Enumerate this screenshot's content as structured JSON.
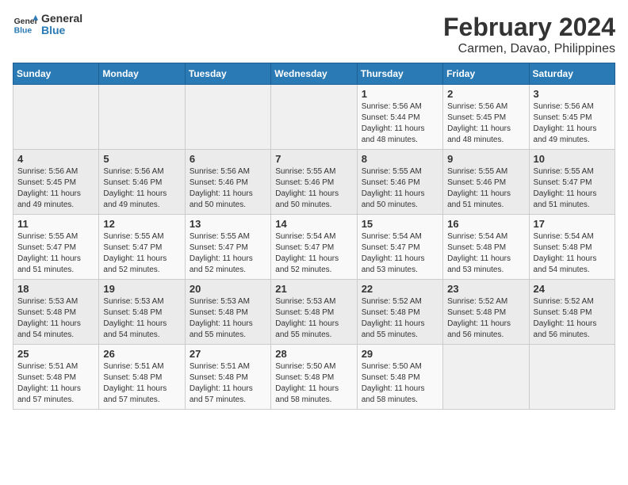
{
  "header": {
    "logo_line1": "General",
    "logo_line2": "Blue",
    "month_year": "February 2024",
    "location": "Carmen, Davao, Philippines"
  },
  "weekdays": [
    "Sunday",
    "Monday",
    "Tuesday",
    "Wednesday",
    "Thursday",
    "Friday",
    "Saturday"
  ],
  "weeks": [
    [
      {
        "day": "",
        "detail": ""
      },
      {
        "day": "",
        "detail": ""
      },
      {
        "day": "",
        "detail": ""
      },
      {
        "day": "",
        "detail": ""
      },
      {
        "day": "1",
        "detail": "Sunrise: 5:56 AM\nSunset: 5:44 PM\nDaylight: 11 hours\nand 48 minutes."
      },
      {
        "day": "2",
        "detail": "Sunrise: 5:56 AM\nSunset: 5:45 PM\nDaylight: 11 hours\nand 48 minutes."
      },
      {
        "day": "3",
        "detail": "Sunrise: 5:56 AM\nSunset: 5:45 PM\nDaylight: 11 hours\nand 49 minutes."
      }
    ],
    [
      {
        "day": "4",
        "detail": "Sunrise: 5:56 AM\nSunset: 5:45 PM\nDaylight: 11 hours\nand 49 minutes."
      },
      {
        "day": "5",
        "detail": "Sunrise: 5:56 AM\nSunset: 5:46 PM\nDaylight: 11 hours\nand 49 minutes."
      },
      {
        "day": "6",
        "detail": "Sunrise: 5:56 AM\nSunset: 5:46 PM\nDaylight: 11 hours\nand 50 minutes."
      },
      {
        "day": "7",
        "detail": "Sunrise: 5:55 AM\nSunset: 5:46 PM\nDaylight: 11 hours\nand 50 minutes."
      },
      {
        "day": "8",
        "detail": "Sunrise: 5:55 AM\nSunset: 5:46 PM\nDaylight: 11 hours\nand 50 minutes."
      },
      {
        "day": "9",
        "detail": "Sunrise: 5:55 AM\nSunset: 5:46 PM\nDaylight: 11 hours\nand 51 minutes."
      },
      {
        "day": "10",
        "detail": "Sunrise: 5:55 AM\nSunset: 5:47 PM\nDaylight: 11 hours\nand 51 minutes."
      }
    ],
    [
      {
        "day": "11",
        "detail": "Sunrise: 5:55 AM\nSunset: 5:47 PM\nDaylight: 11 hours\nand 51 minutes."
      },
      {
        "day": "12",
        "detail": "Sunrise: 5:55 AM\nSunset: 5:47 PM\nDaylight: 11 hours\nand 52 minutes."
      },
      {
        "day": "13",
        "detail": "Sunrise: 5:55 AM\nSunset: 5:47 PM\nDaylight: 11 hours\nand 52 minutes."
      },
      {
        "day": "14",
        "detail": "Sunrise: 5:54 AM\nSunset: 5:47 PM\nDaylight: 11 hours\nand 52 minutes."
      },
      {
        "day": "15",
        "detail": "Sunrise: 5:54 AM\nSunset: 5:47 PM\nDaylight: 11 hours\nand 53 minutes."
      },
      {
        "day": "16",
        "detail": "Sunrise: 5:54 AM\nSunset: 5:48 PM\nDaylight: 11 hours\nand 53 minutes."
      },
      {
        "day": "17",
        "detail": "Sunrise: 5:54 AM\nSunset: 5:48 PM\nDaylight: 11 hours\nand 54 minutes."
      }
    ],
    [
      {
        "day": "18",
        "detail": "Sunrise: 5:53 AM\nSunset: 5:48 PM\nDaylight: 11 hours\nand 54 minutes."
      },
      {
        "day": "19",
        "detail": "Sunrise: 5:53 AM\nSunset: 5:48 PM\nDaylight: 11 hours\nand 54 minutes."
      },
      {
        "day": "20",
        "detail": "Sunrise: 5:53 AM\nSunset: 5:48 PM\nDaylight: 11 hours\nand 55 minutes."
      },
      {
        "day": "21",
        "detail": "Sunrise: 5:53 AM\nSunset: 5:48 PM\nDaylight: 11 hours\nand 55 minutes."
      },
      {
        "day": "22",
        "detail": "Sunrise: 5:52 AM\nSunset: 5:48 PM\nDaylight: 11 hours\nand 55 minutes."
      },
      {
        "day": "23",
        "detail": "Sunrise: 5:52 AM\nSunset: 5:48 PM\nDaylight: 11 hours\nand 56 minutes."
      },
      {
        "day": "24",
        "detail": "Sunrise: 5:52 AM\nSunset: 5:48 PM\nDaylight: 11 hours\nand 56 minutes."
      }
    ],
    [
      {
        "day": "25",
        "detail": "Sunrise: 5:51 AM\nSunset: 5:48 PM\nDaylight: 11 hours\nand 57 minutes."
      },
      {
        "day": "26",
        "detail": "Sunrise: 5:51 AM\nSunset: 5:48 PM\nDaylight: 11 hours\nand 57 minutes."
      },
      {
        "day": "27",
        "detail": "Sunrise: 5:51 AM\nSunset: 5:48 PM\nDaylight: 11 hours\nand 57 minutes."
      },
      {
        "day": "28",
        "detail": "Sunrise: 5:50 AM\nSunset: 5:48 PM\nDaylight: 11 hours\nand 58 minutes."
      },
      {
        "day": "29",
        "detail": "Sunrise: 5:50 AM\nSunset: 5:48 PM\nDaylight: 11 hours\nand 58 minutes."
      },
      {
        "day": "",
        "detail": ""
      },
      {
        "day": "",
        "detail": ""
      }
    ]
  ]
}
